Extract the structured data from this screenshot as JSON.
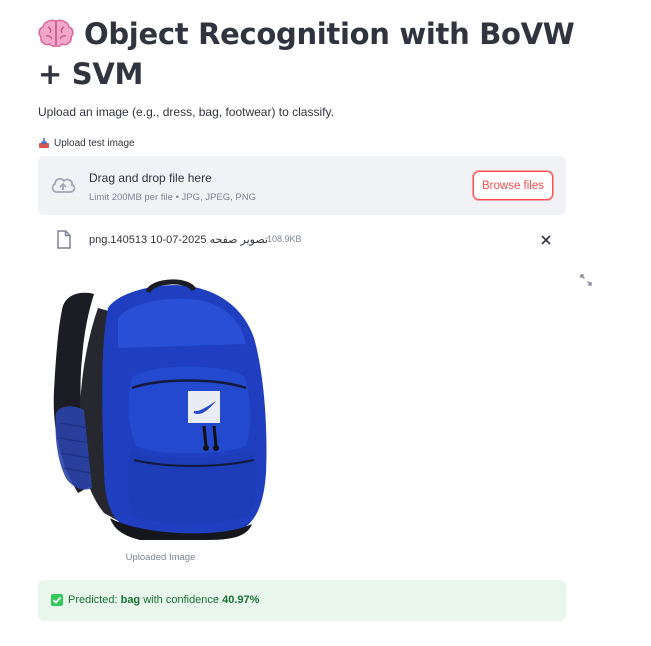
{
  "header": {
    "title": "Object Recognition with BoVW + SVM",
    "icon": "brain-icon"
  },
  "intro": {
    "subtitle": "Upload an image (e.g., dress, bag, footwear) to classify."
  },
  "uploader": {
    "label": "Upload test image",
    "label_icon": "inbox-tray-icon",
    "drop_title": "Drag and drop file here",
    "drop_limits": "Limit 200MB per file • JPG, JPEG, PNG",
    "browse_label": "Browse files",
    "accent_color": "#ff4b4b"
  },
  "file": {
    "name": "تصویر صفحه 2025-07-10 140513.png",
    "size": "108.9KB"
  },
  "image": {
    "caption": "Uploaded Image"
  },
  "prediction": {
    "prefix": "Predicted: ",
    "label": "bag",
    "middle": " with confidence ",
    "confidence": "40.97%",
    "status_color": "#177233",
    "background": "#e8f6ec"
  }
}
